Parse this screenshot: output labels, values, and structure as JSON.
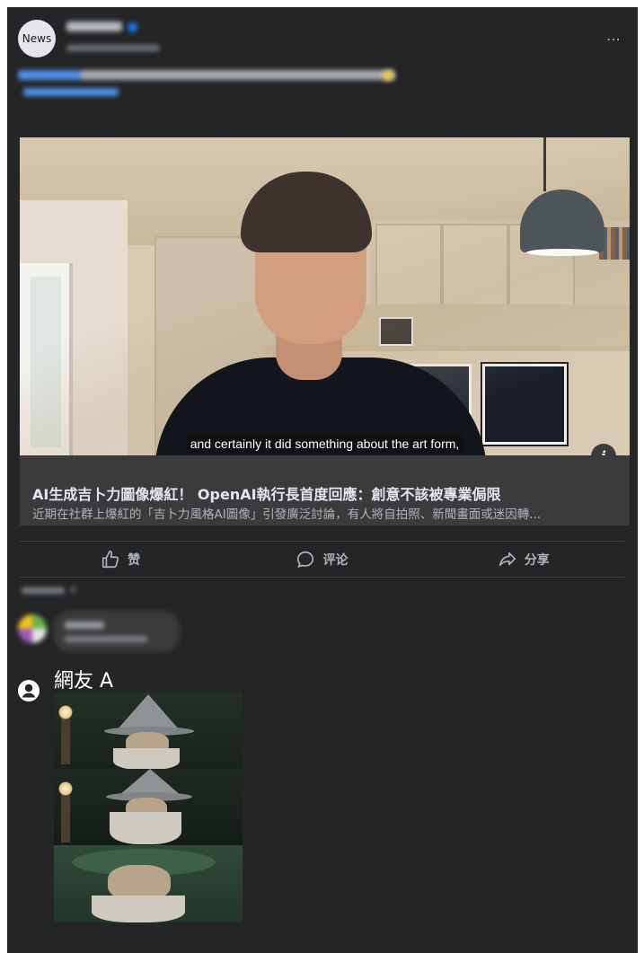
{
  "post": {
    "avatar_label": "News",
    "more_icon": "more-horizontal-icon"
  },
  "media": {
    "subtitle": "and certainly it did something about the art form,",
    "info_icon": "i"
  },
  "link": {
    "title": "AI生成吉卜力圖像爆紅！ OpenAI執行長首度回應：創意不該被專業侷限",
    "description": "近期在社群上爆紅的「吉卜力風格AI圖像」引發廣泛討論，有人將自拍照、新聞畫面或迷因轉..."
  },
  "actions": {
    "like": "赞",
    "comment": "评论",
    "share": "分享"
  },
  "reply": {
    "user_name": "網友 A"
  },
  "colors": {
    "card_bg": "#242526",
    "link_bg": "#3a3b3c",
    "text_primary": "#e4e6eb",
    "text_secondary": "#b0b3b8",
    "accent": "#1877f2"
  }
}
